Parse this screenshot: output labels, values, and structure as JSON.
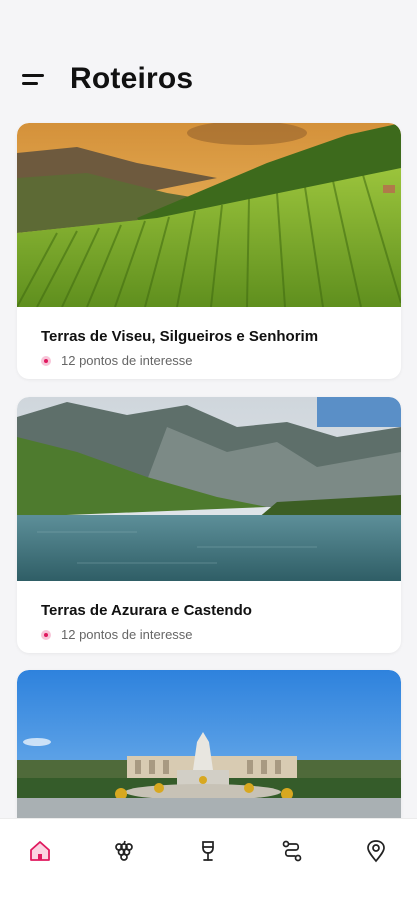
{
  "header": {
    "title": "Roteiros",
    "menu_icon": "hamburger-menu-icon"
  },
  "routes": [
    {
      "title": "Terras de Viseu, Silgueiros e Senhorim",
      "points": "12 pontos de interesse",
      "image": "vineyard-hills-photo"
    },
    {
      "title": "Terras de Azurara e Castendo",
      "points": "12 pontos de interesse",
      "image": "mountain-lake-photo"
    },
    {
      "title": "",
      "points": "",
      "image": "palace-fountain-photo"
    }
  ],
  "tabbar": {
    "items": [
      {
        "icon": "home-icon",
        "active": true
      },
      {
        "icon": "grapes-icon",
        "active": false
      },
      {
        "icon": "wine-glass-icon",
        "active": false
      },
      {
        "icon": "route-icon",
        "active": false
      },
      {
        "icon": "location-pin-icon",
        "active": false
      }
    ]
  },
  "colors": {
    "accent": "#e0195f",
    "background": "#f5f5f7",
    "inactive_icon": "#222222"
  }
}
